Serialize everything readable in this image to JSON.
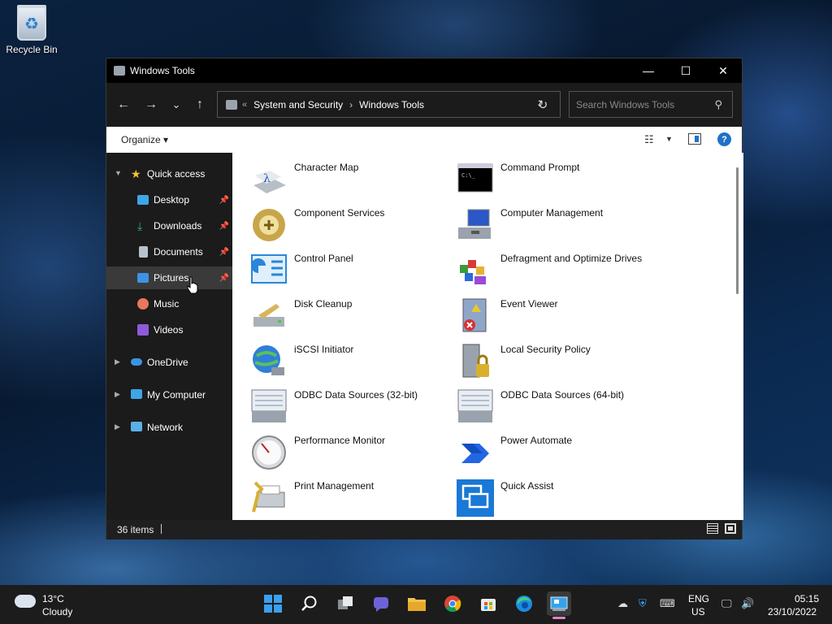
{
  "desktop": {
    "recycle_bin_label": "Recycle Bin"
  },
  "window": {
    "title": "Windows Tools",
    "controls": {
      "minimize": "—",
      "maximize": "☐",
      "close": "✕"
    },
    "nav": {
      "back": "←",
      "forward": "→",
      "recent": "⌄",
      "up": "↑"
    },
    "address": {
      "chevron": "«",
      "crumbs": [
        "System and Security",
        "Windows Tools"
      ],
      "separator": "›",
      "dropdown": "⌄",
      "refresh": "↻"
    },
    "search": {
      "placeholder": "Search Windows Tools",
      "icon": "⚲"
    },
    "commandbar": {
      "organize": "Organize ▾",
      "view_icon": "☷",
      "view_dropdown": "▼",
      "help": "?"
    },
    "sidebar": {
      "items": [
        {
          "label": "Quick access",
          "icon": "star-icon",
          "color": "#f2c531"
        },
        {
          "label": "Desktop",
          "icon": "desktop-icon",
          "color": "#3ea6e6"
        },
        {
          "label": "Downloads",
          "icon": "download-icon",
          "color": "#2fb27a"
        },
        {
          "label": "Documents",
          "icon": "document-icon",
          "color": "#b7c2cc"
        },
        {
          "label": "Pictures",
          "icon": "pictures-icon",
          "color": "#3d93e3"
        },
        {
          "label": "Music",
          "icon": "music-icon",
          "color": "#e7775d"
        },
        {
          "label": "Videos",
          "icon": "video-icon",
          "color": "#8e5bd8"
        },
        {
          "label": "OneDrive",
          "icon": "cloud-icon",
          "color": "#3d93e3"
        },
        {
          "label": "My Computer",
          "icon": "computer-icon",
          "color": "#3ea6e6"
        },
        {
          "label": "Network",
          "icon": "network-icon",
          "color": "#5ab0e8"
        }
      ]
    },
    "items": [
      {
        "label": "Character Map",
        "icon": "character-map-icon"
      },
      {
        "label": "Command Prompt",
        "icon": "command-prompt-icon"
      },
      {
        "label": "Component Services",
        "icon": "component-services-icon"
      },
      {
        "label": "Computer Management",
        "icon": "computer-management-icon"
      },
      {
        "label": "Control Panel",
        "icon": "control-panel-icon"
      },
      {
        "label": "Defragment and Optimize Drives",
        "icon": "defragment-icon"
      },
      {
        "label": "Disk Cleanup",
        "icon": "disk-cleanup-icon"
      },
      {
        "label": "Event Viewer",
        "icon": "event-viewer-icon"
      },
      {
        "label": "iSCSI Initiator",
        "icon": "iscsi-icon"
      },
      {
        "label": "Local Security Policy",
        "icon": "security-policy-icon"
      },
      {
        "label": "ODBC Data Sources (32-bit)",
        "icon": "odbc-icon"
      },
      {
        "label": "ODBC Data Sources (64-bit)",
        "icon": "odbc-icon"
      },
      {
        "label": "Performance Monitor",
        "icon": "performance-monitor-icon"
      },
      {
        "label": "Power Automate",
        "icon": "power-automate-icon"
      },
      {
        "label": "Print Management",
        "icon": "print-management-icon"
      },
      {
        "label": "Quick Assist",
        "icon": "quick-assist-icon"
      }
    ],
    "status": {
      "count": "36 items"
    }
  },
  "taskbar": {
    "weather": {
      "temp": "13°C",
      "desc": "Cloudy"
    },
    "tray": {
      "lang1": "ENG",
      "lang2": "US",
      "time": "05:15",
      "date": "23/10/2022"
    }
  }
}
